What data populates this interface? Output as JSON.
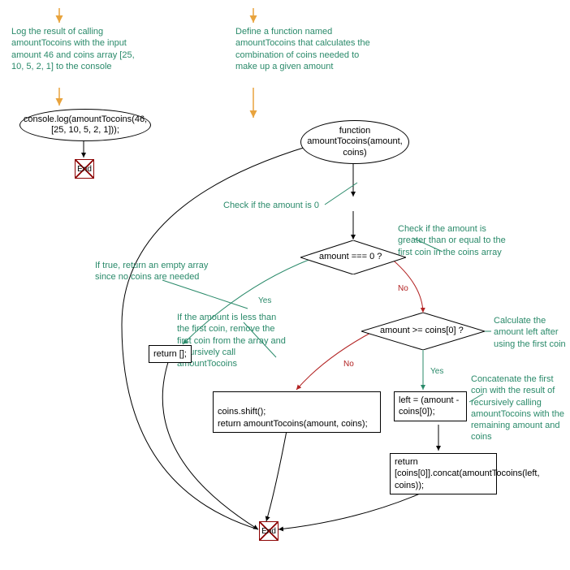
{
  "nodes": {
    "start1_text": "console.log(amountTocoins(46, [25, 10, 5, 2, 1]));",
    "end1": "End",
    "func_def": "function amountTocoins(amount, coins)",
    "cond1": "amount === 0 ?",
    "cond2": "amount >= coins[0] ?",
    "return_empty": "return [];",
    "shift_block": "coins.shift();\nreturn amountTocoins(amount, coins);",
    "left_block": "left = (amount - coins[0]);",
    "concat_block": "return [coins[0]].concat(amountTocoins(left, coins));",
    "end2": "End"
  },
  "annotations": {
    "a1": "Log the result of calling amountTocoins with the input amount 46 and coins array [25, 10, 5, 2, 1] to the console",
    "a2": "Define a function named amountTocoins that calculates the combination of coins needed to make up a given amount",
    "a3": "Check if the amount is 0",
    "a4": "If true, return an empty array since no coins are needed",
    "a5": "Check if the amount is greater than or equal to the first coin in the coins array",
    "a6": "If the amount is less than the first coin, remove the first coin from the array and recursively call amountTocoins",
    "a7": "Calculate the amount left after using the first coin",
    "a8": "Concatenate the first coin with the result of recursively calling amountTocoins with the remaining amount and coins"
  },
  "edge_labels": {
    "yes": "Yes",
    "no": "No"
  }
}
